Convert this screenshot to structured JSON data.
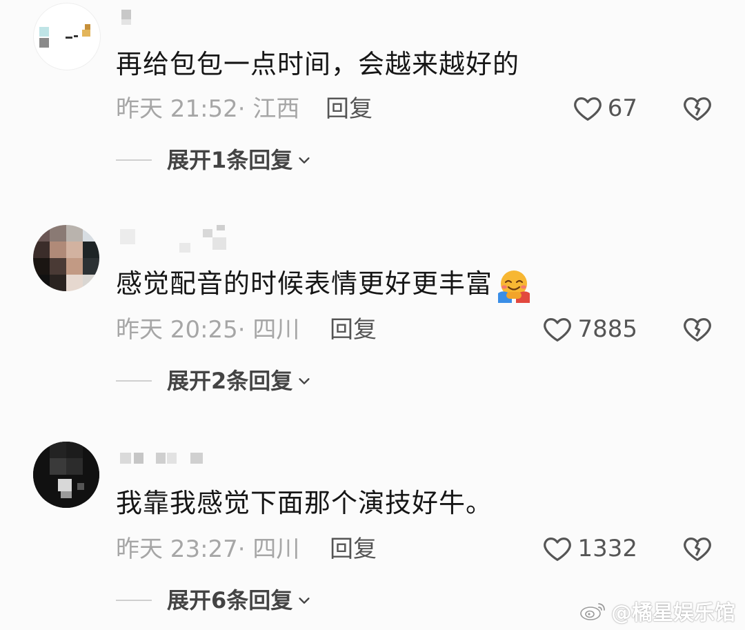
{
  "comments": [
    {
      "text": "再给包包一点时间，会越来越好的",
      "meta": "昨天 21:52· 江西",
      "reply_label": "回复",
      "likes": "67",
      "expand_label": "展开1条回复"
    },
    {
      "text": "感觉配音的时候表情更好更丰富",
      "emoji": "hugging-face-emoji",
      "meta": "昨天 20:25· 四川",
      "reply_label": "回复",
      "likes": "7885",
      "expand_label": "展开2条回复"
    },
    {
      "text": "我靠我感觉下面那个演技好牛。",
      "meta": "昨天 23:27· 四川",
      "reply_label": "回复",
      "likes": "1332",
      "expand_label": "展开6条回复"
    }
  ],
  "icons": {
    "like": "heart-outline-icon",
    "dislike": "broken-heart-icon",
    "expand": "chevron-down-icon",
    "watermark": "weibo-logo-icon"
  },
  "watermark": {
    "text": "@橘星娱乐馆"
  },
  "colors": {
    "background": "#fbfbfb",
    "meta_text": "#a6a6a6",
    "body_text": "#161616"
  }
}
